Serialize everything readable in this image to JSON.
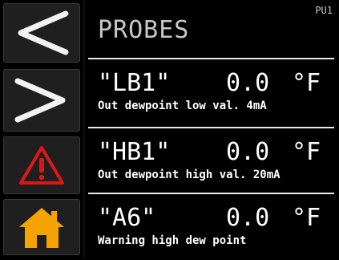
{
  "header": {
    "title": "PROBES",
    "unit_id": "PU1"
  },
  "nav": [
    {
      "icon": "chevron-left-icon",
      "label": "Back"
    },
    {
      "icon": "chevron-right-icon",
      "label": "Next"
    },
    {
      "icon": "warning-icon",
      "label": "Alarms",
      "color": "#e01616"
    },
    {
      "icon": "home-icon",
      "label": "Home",
      "color": "#f5a300"
    }
  ],
  "probes": [
    {
      "name": "\"LB1\"",
      "value": "0.0",
      "unit": "°F",
      "description": "Out dewpoint low val. 4mA"
    },
    {
      "name": "\"HB1\"",
      "value": "0.0",
      "unit": "°F",
      "description": "Out dewpoint high val. 20mA"
    },
    {
      "name": "\"A6\"",
      "value": "0.0",
      "unit": "°F",
      "description": "Warning high dew point"
    }
  ],
  "colors": {
    "background": "#000000",
    "button": "#1f1f1f",
    "separator": "#e9e9e9",
    "alert": "#e01616",
    "home": "#f5a300"
  }
}
